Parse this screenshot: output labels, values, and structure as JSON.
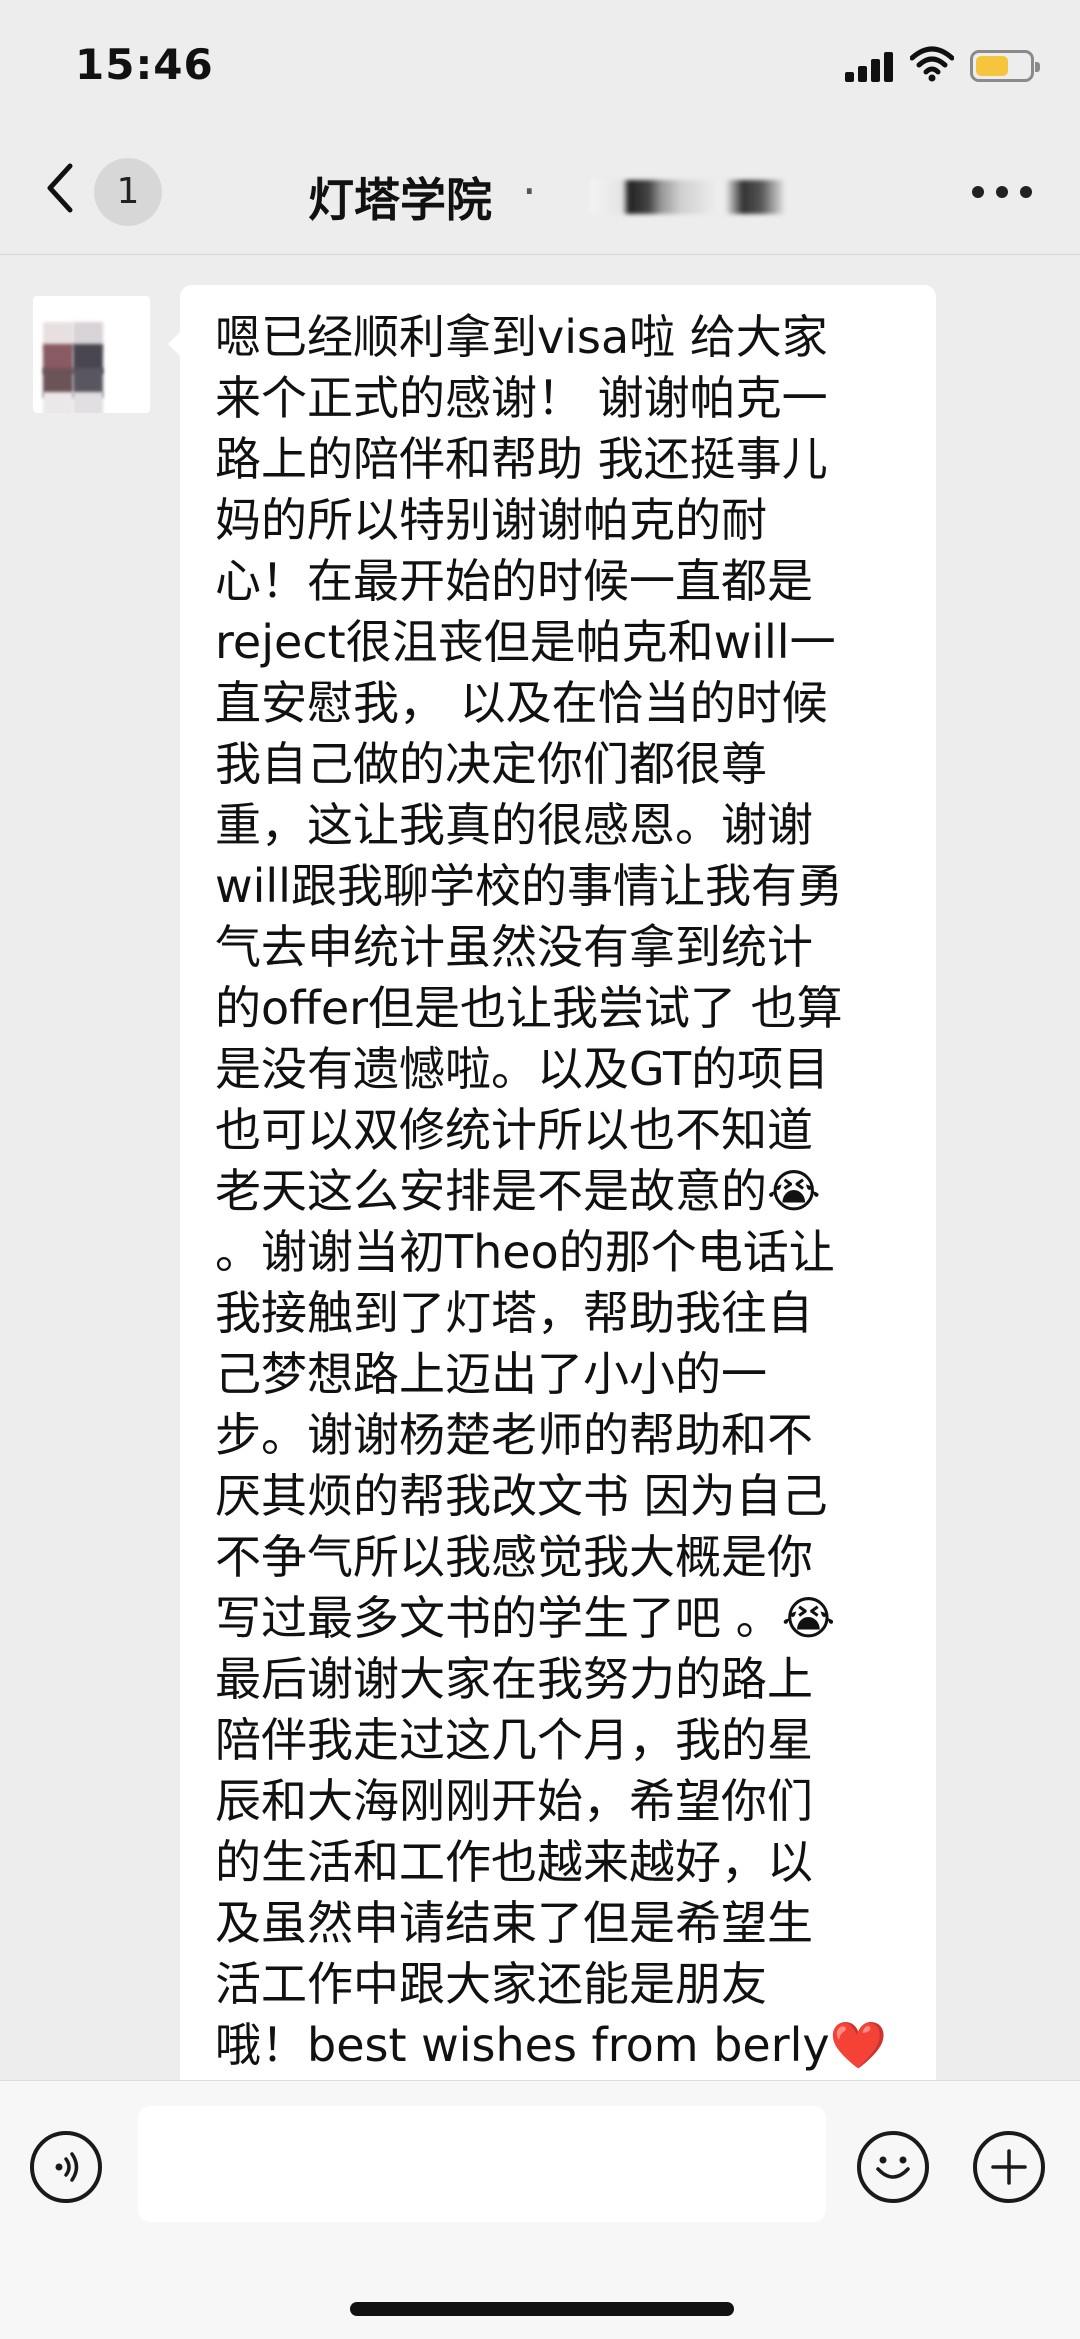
{
  "status_bar": {
    "time": "15:46",
    "signal_icon": "cellular-signal-icon",
    "wifi_icon": "wifi-icon",
    "battery_icon": "battery-icon",
    "battery_color": "#f5c53d"
  },
  "nav": {
    "back_icon": "chevron-left-icon",
    "unread_count": "1",
    "title": "灯塔学院",
    "title_separator": "·",
    "more_icon": "more-dots-icon"
  },
  "message": {
    "text": "嗯已经顺利拿到visa啦 给大家\n来个正式的感谢！ 谢谢帕克一\n路上的陪伴和帮助 我还挺事儿\n妈的所以特别谢谢帕克的耐\n心！在最开始的时候一直都是\nreject很沮丧但是帕克和will一\n直安慰我， 以及在恰当的时候\n我自己做的决定你们都很尊\n重，这让我真的很感恩。谢谢\nwill跟我聊学校的事情让我有勇\n气去申统计虽然没有拿到统计\n的offer但是也让我尝试了 也算\n是没有遗憾啦。以及GT的项目\n也可以双修统计所以也不知道\n老天这么安排是不是故意的😭\n。谢谢当初Theo的那个电话让\n我接触到了灯塔，帮助我往自\n己梦想路上迈出了小小的一\n步。谢谢杨楚老师的帮助和不\n厌其烦的帮我改文书 因为自己\n不争气所以我感觉我大概是你\n写过最多文书的学生了吧 。😭\n最后谢谢大家在我努力的路上\n陪伴我走过这几个月，我的星\n辰和大海刚刚开始，希望你们\n的生活和工作也越来越好，以\n及虽然申请结束了但是希望生\n活工作中跟大家还能是朋友\n哦！best wishes from berly❤️"
  },
  "input_bar": {
    "voice_icon": "voice-input-icon",
    "text_value": "",
    "emoji_icon": "emoji-icon",
    "plus_icon": "plus-icon"
  }
}
